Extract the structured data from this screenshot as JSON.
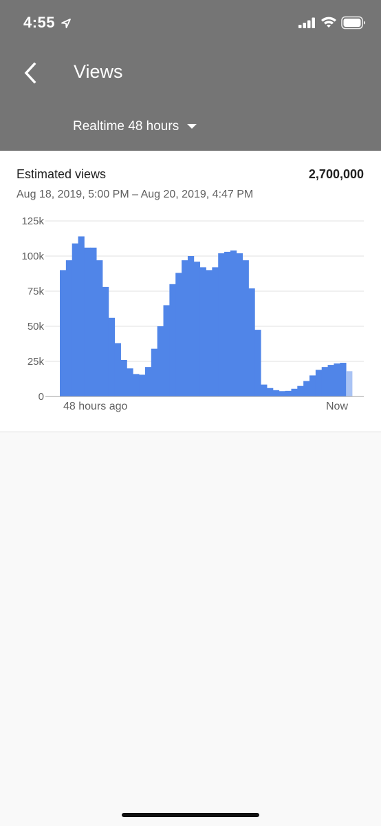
{
  "status_bar": {
    "time": "4:55",
    "icons": [
      "location-arrow-icon",
      "cellular-signal-icon",
      "wifi-icon",
      "battery-icon"
    ]
  },
  "header": {
    "title": "Views",
    "back_icon": "chevron-left-icon",
    "range_label": "Realtime 48 hours",
    "range_icon": "caret-down-icon",
    "background_color": "#757575"
  },
  "card": {
    "metric": "Estimated views",
    "total": "2,700,000",
    "date_range": "Aug 18, 2019, 5:00 PM – Aug 20, 2019, 4:47 PM"
  },
  "chart_data": {
    "type": "bar",
    "title": "",
    "xlabel": "",
    "ylabel": "",
    "x_tick_labels": [
      "48 hours ago",
      "Now"
    ],
    "y_ticks": [
      0,
      25000,
      50000,
      75000,
      100000,
      125000
    ],
    "y_tick_labels": [
      "0",
      "25k",
      "50k",
      "75k",
      "100k",
      "125k"
    ],
    "ylim": [
      0,
      125000
    ],
    "grid": true,
    "bar_color": "#5085e8",
    "partial_bar_color": "#a9c3f4",
    "values": [
      90000,
      97000,
      109000,
      114000,
      106000,
      106000,
      97000,
      78000,
      56000,
      38000,
      26000,
      20000,
      16000,
      15500,
      21000,
      34000,
      50000,
      65000,
      80000,
      88000,
      97000,
      100000,
      96000,
      92000,
      90000,
      92000,
      102000,
      103000,
      104000,
      102000,
      97000,
      77000,
      47500,
      8500,
      6000,
      4500,
      3800,
      4000,
      5500,
      7500,
      11000,
      15000,
      19000,
      21000,
      22500,
      23500,
      24000,
      18000
    ],
    "partial_last_bar": true
  }
}
